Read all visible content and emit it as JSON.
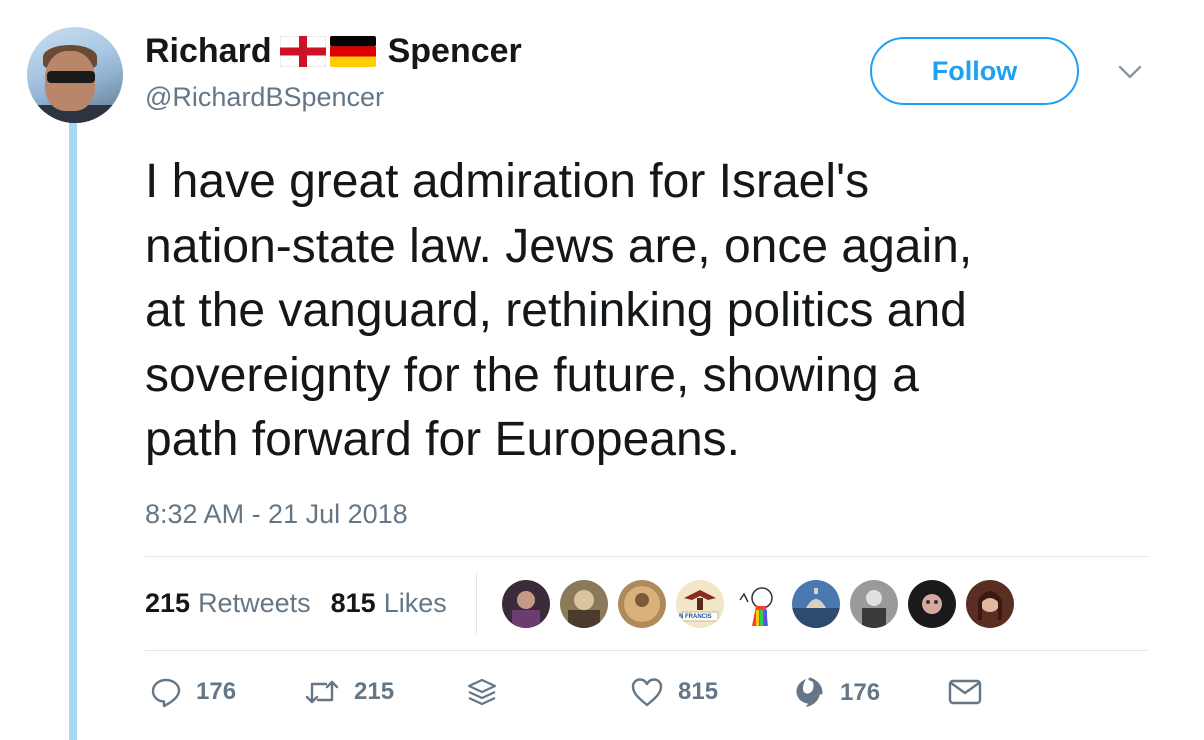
{
  "author": {
    "name_first": "Richard",
    "name_last": "Spencer",
    "flags": [
      "england-flag-icon",
      "germany-flag-icon"
    ],
    "handle": "@RichardBSpencer"
  },
  "follow_label": "Follow",
  "tweet": {
    "text": "I have great admiration for Israel's\nnation-state law. Jews are, once again,\nat the vanguard, rethinking politics and\nsovereignty for the future, showing a\npath forward for Europeans.",
    "timestamp": "8:32 AM - 21 Jul 2018"
  },
  "stats": {
    "retweets_count": "215",
    "retweets_label": "Retweets",
    "likes_count": "815",
    "likes_label": "Likes"
  },
  "likers": [
    {
      "name": "liker-1",
      "color": "#3b2b3a"
    },
    {
      "name": "liker-2",
      "color": "#8a7a5a"
    },
    {
      "name": "liker-3",
      "color": "#b08a5a"
    },
    {
      "name": "liker-4",
      "color": "#f2e7c9",
      "caption": "N FRANCIS"
    },
    {
      "name": "liker-5",
      "color": "#ffffff"
    },
    {
      "name": "liker-6",
      "color": "#4a78b0"
    },
    {
      "name": "liker-7",
      "color": "#9a9a9a"
    },
    {
      "name": "liker-8",
      "color": "#1a1a1a"
    },
    {
      "name": "liker-9",
      "color": "#5a2e22"
    }
  ],
  "actions": {
    "reply_count": "176",
    "retweet_count": "215",
    "like_count": "815",
    "disqus_count": "176"
  },
  "colors": {
    "accent": "#1da1f2",
    "text_primary": "#14171a",
    "text_secondary": "#657786",
    "thread_line": "#a7d7f5",
    "divider": "#e1e8ed"
  }
}
